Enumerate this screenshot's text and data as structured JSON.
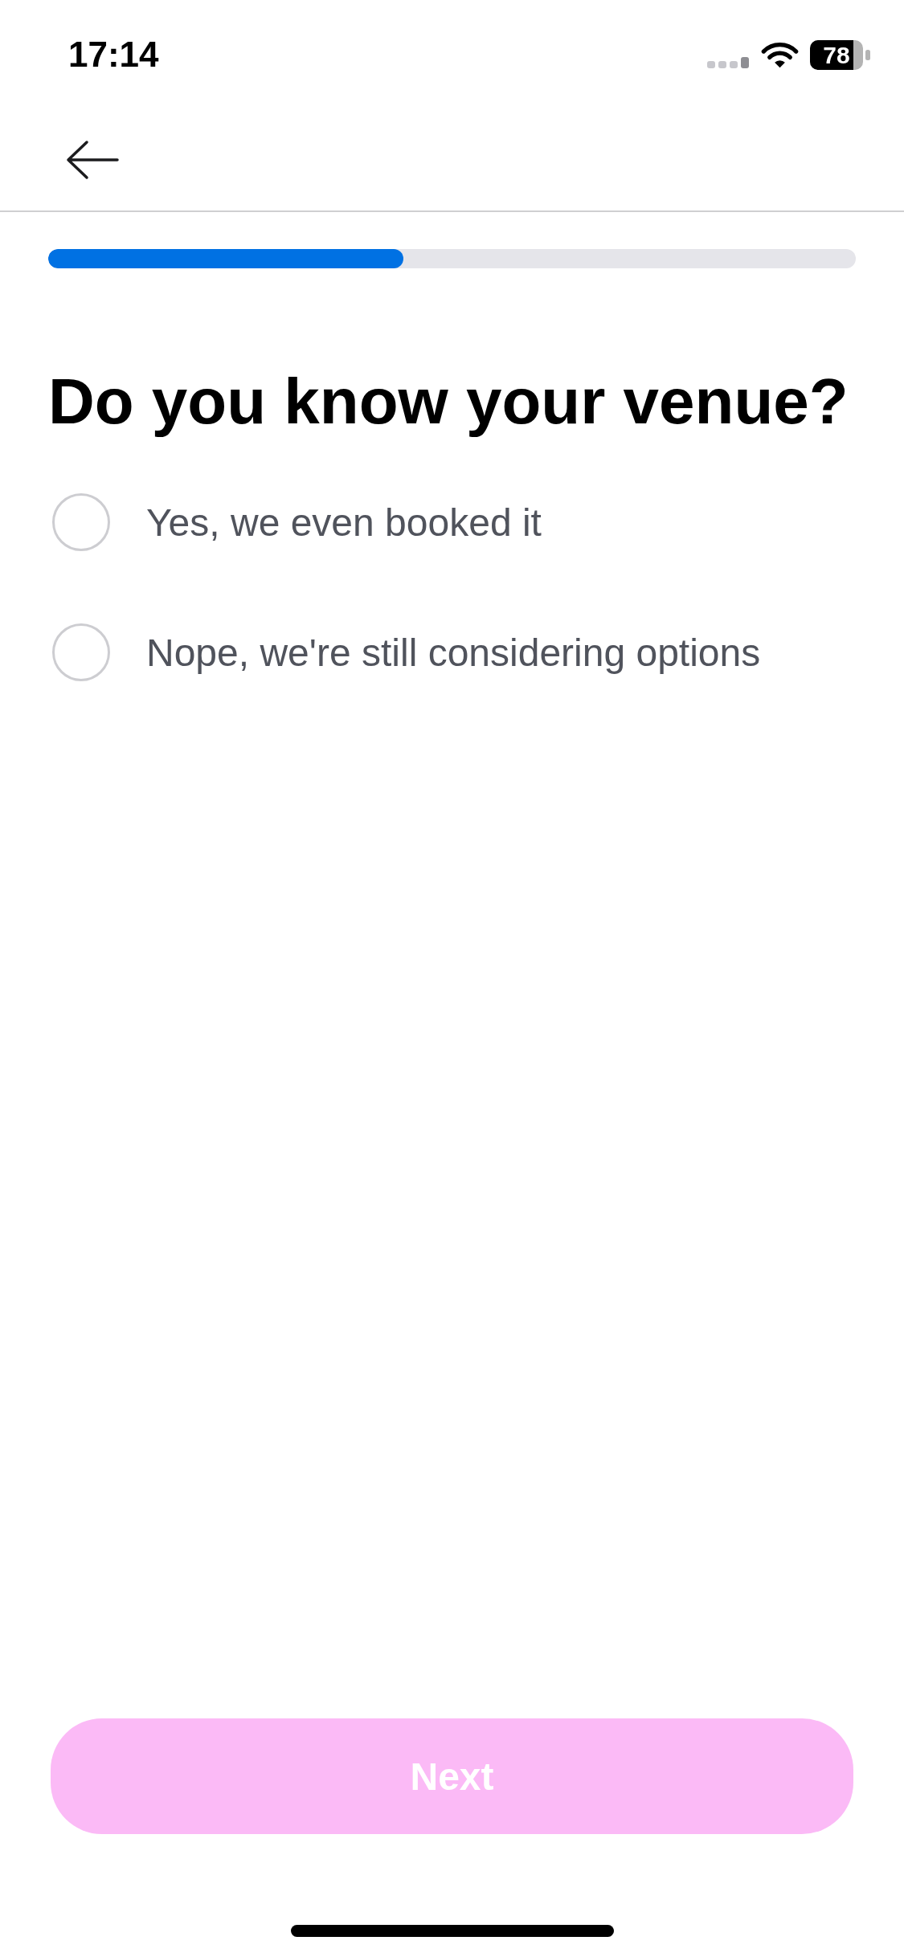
{
  "status_bar": {
    "time": "17:14",
    "battery": "78"
  },
  "progress": {
    "level": 0.44
  },
  "question": "Do you know your venue?",
  "options": [
    {
      "label": "Yes, we even booked it",
      "selected": false
    },
    {
      "label": "Nope, we're still considering options",
      "selected": false
    }
  ],
  "next_button": {
    "label": "Next",
    "disabled": true
  }
}
